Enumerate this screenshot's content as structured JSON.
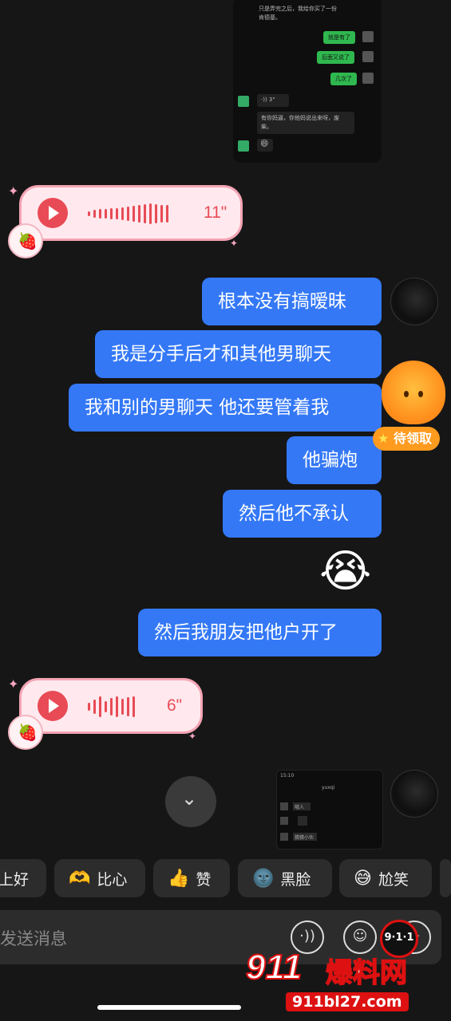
{
  "top_screenshot": {
    "line1": "只是弄完之后，我给你买了一份",
    "line2": "肯德基。",
    "green1": "就是有了",
    "green2": "后面又说了",
    "green3": "几次了",
    "voice_label": "·)) 3\"",
    "gray_line1": "有你妈逼，你他妈说出来呀，废",
    "gray_line2": "柴。",
    "emoji": "😄"
  },
  "voice1": {
    "duration": "11\""
  },
  "messages": [
    "根本没有搞暧昧",
    "我是分手后才和其他男聊天",
    "我和别的男聊天 他还要管着我",
    "他骗炮",
    "然后他不承认",
    "然后我朋友把他户开了"
  ],
  "emoji_big": "😭",
  "badge_label": "待领取",
  "voice2": {
    "duration": "6\""
  },
  "bottom_screenshot": {
    "time": "15:10",
    "name": "yuxqi",
    "row1": "哦人",
    "row2": "猜猜小伙"
  },
  "quick_replies": [
    {
      "label": "上好",
      "icon": ""
    },
    {
      "label": "比心",
      "icon": "🫶"
    },
    {
      "label": "赞",
      "icon": "👍"
    },
    {
      "label": "黑脸",
      "icon": "🌚"
    },
    {
      "label": "尬笑",
      "icon": "😅"
    }
  ],
  "input": {
    "placeholder": "发送消息"
  },
  "watermark": {
    "number": "911",
    "text": "爆料网",
    "url": "911bl27.com",
    "badge": "9·1·1"
  }
}
